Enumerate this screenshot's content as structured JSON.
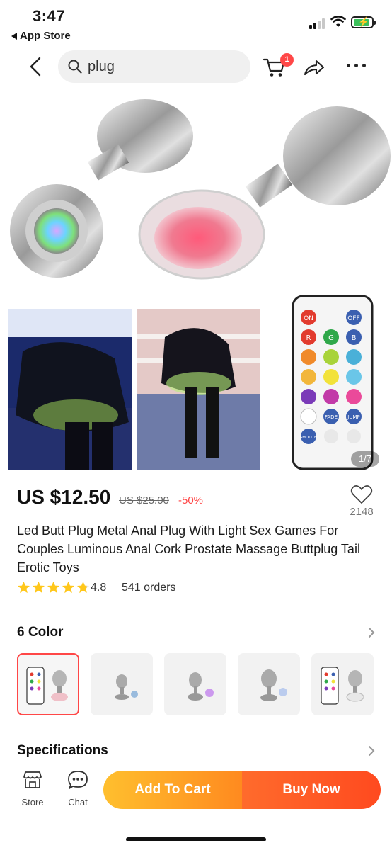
{
  "status_bar": {
    "time": "3:47",
    "back_app": "App Store"
  },
  "nav": {
    "search_value": "plug",
    "cart_badge": "1"
  },
  "gallery": {
    "counter": "1/7"
  },
  "product": {
    "price": "US $12.50",
    "original_price": "US $25.00",
    "discount": "-50%",
    "wishlist_count": "2148",
    "title": "Led Butt Plug Metal Anal Plug With Light Sex Games For Couples Luminous Anal Cork Prostate Massage Buttplug Tail Erotic Toys",
    "rating": "4.8",
    "rating_stars": 4.8,
    "orders": "541 orders"
  },
  "remote_buttons": [
    "ON",
    "OFF",
    "R",
    "G",
    "B",
    "FADE",
    "JUMP",
    "SMOOTH"
  ],
  "variants_section": {
    "label": "6 Color"
  },
  "specifications": {
    "label": "Specifications"
  },
  "bottom_bar": {
    "store_label": "Store",
    "chat_label": "Chat",
    "add_to_cart": "Add To Cart",
    "buy_now": "Buy Now"
  },
  "colors": {
    "accent": "#ff4747",
    "star": "#ffc71a",
    "cart_gradient_start": "#ffbf2e",
    "buy_gradient_end": "#ff4a1f"
  }
}
